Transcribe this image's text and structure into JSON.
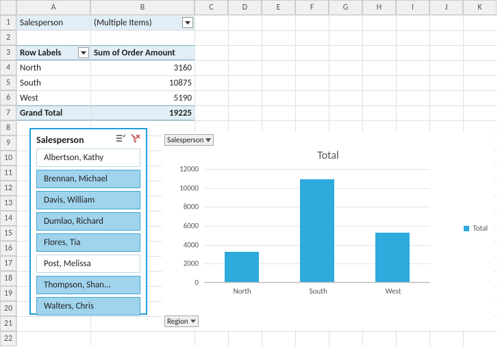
{
  "columns": [
    "A",
    "B",
    "C",
    "D",
    "E",
    "F",
    "G",
    "H",
    "I",
    "J",
    "K"
  ],
  "rows": 22,
  "pivot_filter": {
    "label": "Salesperson",
    "value": "(Multiple Items)"
  },
  "pivot_headers": {
    "rows": "Row Labels",
    "vals": "Sum of Order Amount"
  },
  "pivot_data": [
    {
      "label": "North",
      "value": "3160"
    },
    {
      "label": "South",
      "value": "10875"
    },
    {
      "label": "West",
      "value": "5190"
    }
  ],
  "grand_total": {
    "label": "Grand Total",
    "value": "19225"
  },
  "slicer": {
    "title": "Salesperson",
    "items": [
      {
        "name": "Albertson, Kathy",
        "selected": false
      },
      {
        "name": "Brennan, Michael",
        "selected": true
      },
      {
        "name": "Davis, William",
        "selected": true
      },
      {
        "name": "Dumlao, Richard",
        "selected": true
      },
      {
        "name": "Flores, Tia",
        "selected": true
      },
      {
        "name": "Post, Melissa",
        "selected": false
      },
      {
        "name": "Thompson, Shan...",
        "selected": true
      },
      {
        "name": "Walters, Chris",
        "selected": true
      }
    ]
  },
  "chart": {
    "title": "Total",
    "field_button_top": "Salesperson",
    "field_button_bottom": "Region",
    "legend_label": "Total",
    "y_ticks": [
      "0",
      "2000",
      "4000",
      "6000",
      "8000",
      "10000",
      "12000"
    ]
  },
  "chart_data": {
    "type": "bar",
    "title": "Total",
    "categories": [
      "North",
      "South",
      "West"
    ],
    "values": [
      3160,
      10875,
      5190
    ],
    "ylabel": "",
    "xlabel": "",
    "ylim": [
      0,
      12000
    ],
    "legend": [
      "Total"
    ]
  }
}
